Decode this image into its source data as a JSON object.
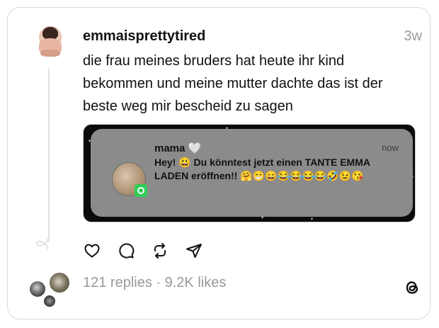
{
  "post": {
    "username": "emmaisprettytired",
    "time": "3w",
    "text": "die frau meines bruders hat heute ihr kind bekommen und meine mutter dachte das ist der beste weg mir bescheid zu sagen"
  },
  "notification": {
    "sender": "mama 🤍",
    "time": "now",
    "message": "Hey! 😃 Du könntest jetzt einen TANTE EMMA LADEN eröffnen!! 🤗😁😄😂😂😂😂🤣😉😘",
    "app_icon": "whatsapp-icon"
  },
  "actions": [
    {
      "icon": "heart-icon"
    },
    {
      "icon": "comment-icon"
    },
    {
      "icon": "repost-icon"
    },
    {
      "icon": "share-icon"
    }
  ],
  "stats": "121 replies · 9.2K likes",
  "logo": "threads-logo-icon"
}
